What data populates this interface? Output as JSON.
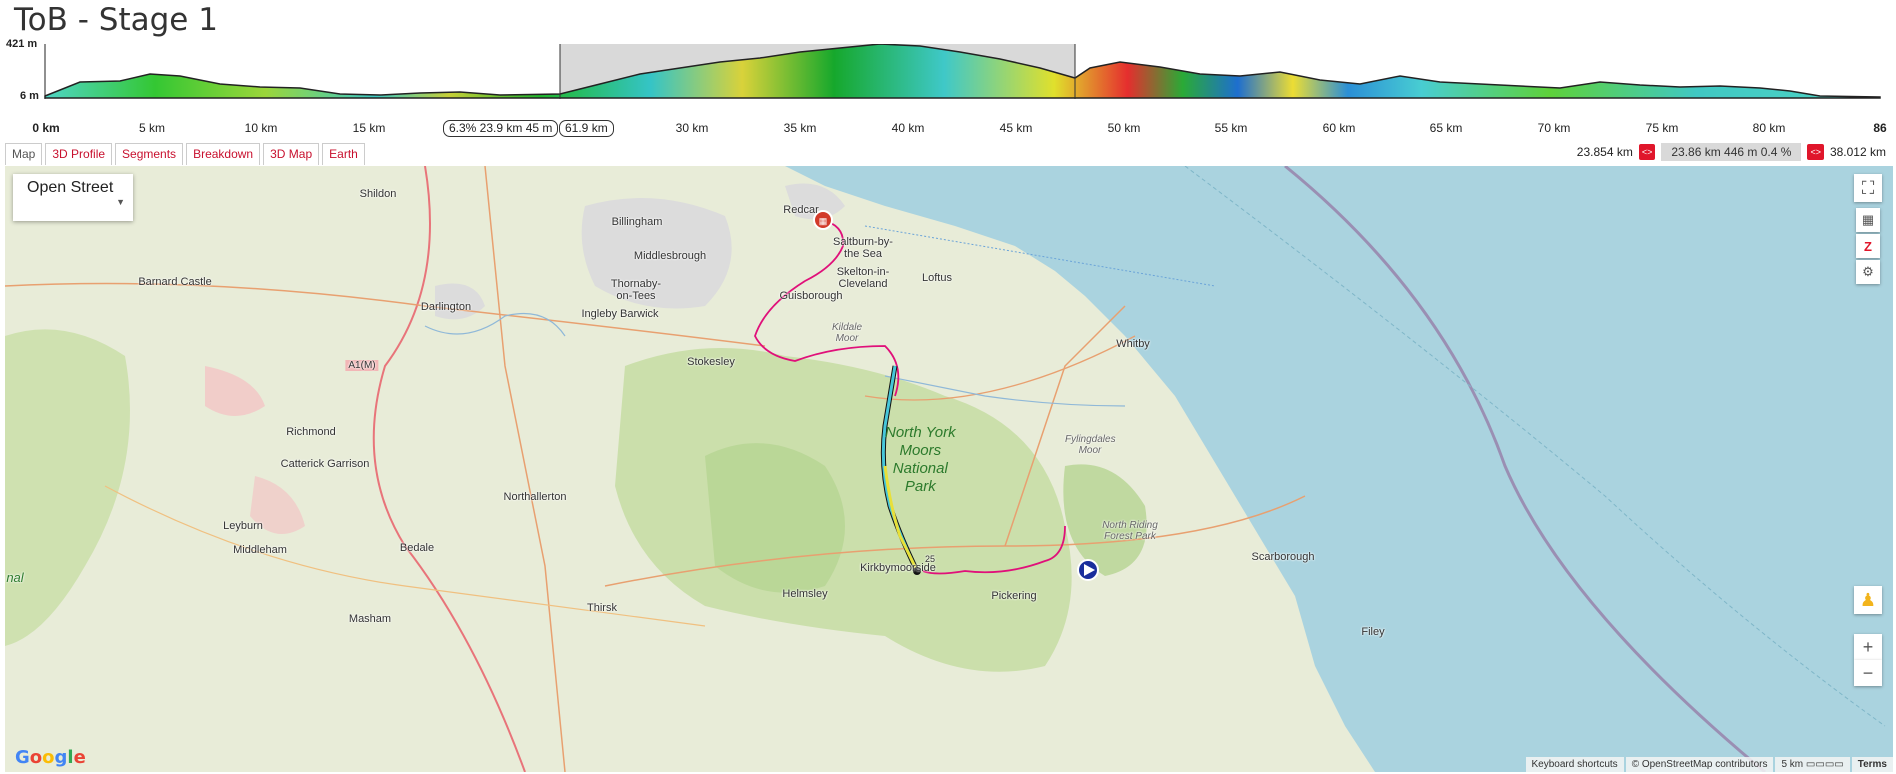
{
  "title": "ToB - Stage 1",
  "profile": {
    "elev_max_label": "421 m",
    "elev_min_label": "6 m",
    "km_ticks": [
      "0 km",
      "5 km",
      "10 km",
      "15 km",
      "30 km",
      "35 km",
      "40 km",
      "45 km",
      "50 km",
      "55 km",
      "60 km",
      "65 km",
      "70 km",
      "75 km",
      "80 km",
      "86"
    ],
    "selection_start_info": "6.3% 23.9 km 45 m",
    "selection_end_info": "61.9 km"
  },
  "tabs": [
    "Map",
    "3D Profile",
    "Segments",
    "Breakdown",
    "3D Map",
    "Earth"
  ],
  "stats": {
    "start": "23.854 km",
    "middle": "23.86 km 446 m 0.4 %",
    "end": "38.012 km",
    "prev_label": "<>",
    "next_label": "<>"
  },
  "map": {
    "map_type": "Open Street",
    "park_label": "North York Moors National Park",
    "towns": {
      "shildon": "Shildon",
      "billingham": "Billingham",
      "redcar": "Redcar",
      "middlesbrough": "Middlesbrough",
      "saltburn": "Saltburn-by-the Sea",
      "skelton": "Skelton-in-Cleveland",
      "loftus": "Loftus",
      "barnard": "Barnard Castle",
      "thornaby": "Thornaby-on-Tees",
      "darlington": "Darlington",
      "guisborough": "Guisborough",
      "ingleby": "Ingleby Barwick",
      "kildale": "Kildale Moor",
      "stokesley": "Stokesley",
      "whitby": "Whitby",
      "a1m": "A1(M)",
      "richmond": "Richmond",
      "catterick": "Catterick Garrison",
      "fylingdales": "Fylingdales Moor",
      "northallerton": "Northallerton",
      "nrfp": "North Riding Forest Park",
      "leyburn": "Leyburn",
      "middleham": "Middleham",
      "bedale": "Bedale",
      "scarborough": "Scarborough",
      "kirkbymoorside": "Kirkbymoorside",
      "helmsley": "Helmsley",
      "pickering": "Pickering",
      "thirsk": "Thirsk",
      "masham": "Masham",
      "filey": "Filey",
      "nal": "nal",
      "marker25": "25"
    },
    "attribution": {
      "shortcuts": "Keyboard shortcuts",
      "osm": "© OpenStreetMap contributors",
      "scale": "5 km",
      "terms": "Terms"
    },
    "google": "Google"
  },
  "colors": {
    "accent": "#c8102e",
    "sea": "#aad3df",
    "route": "#e0107a",
    "park": "#c8dea6"
  }
}
